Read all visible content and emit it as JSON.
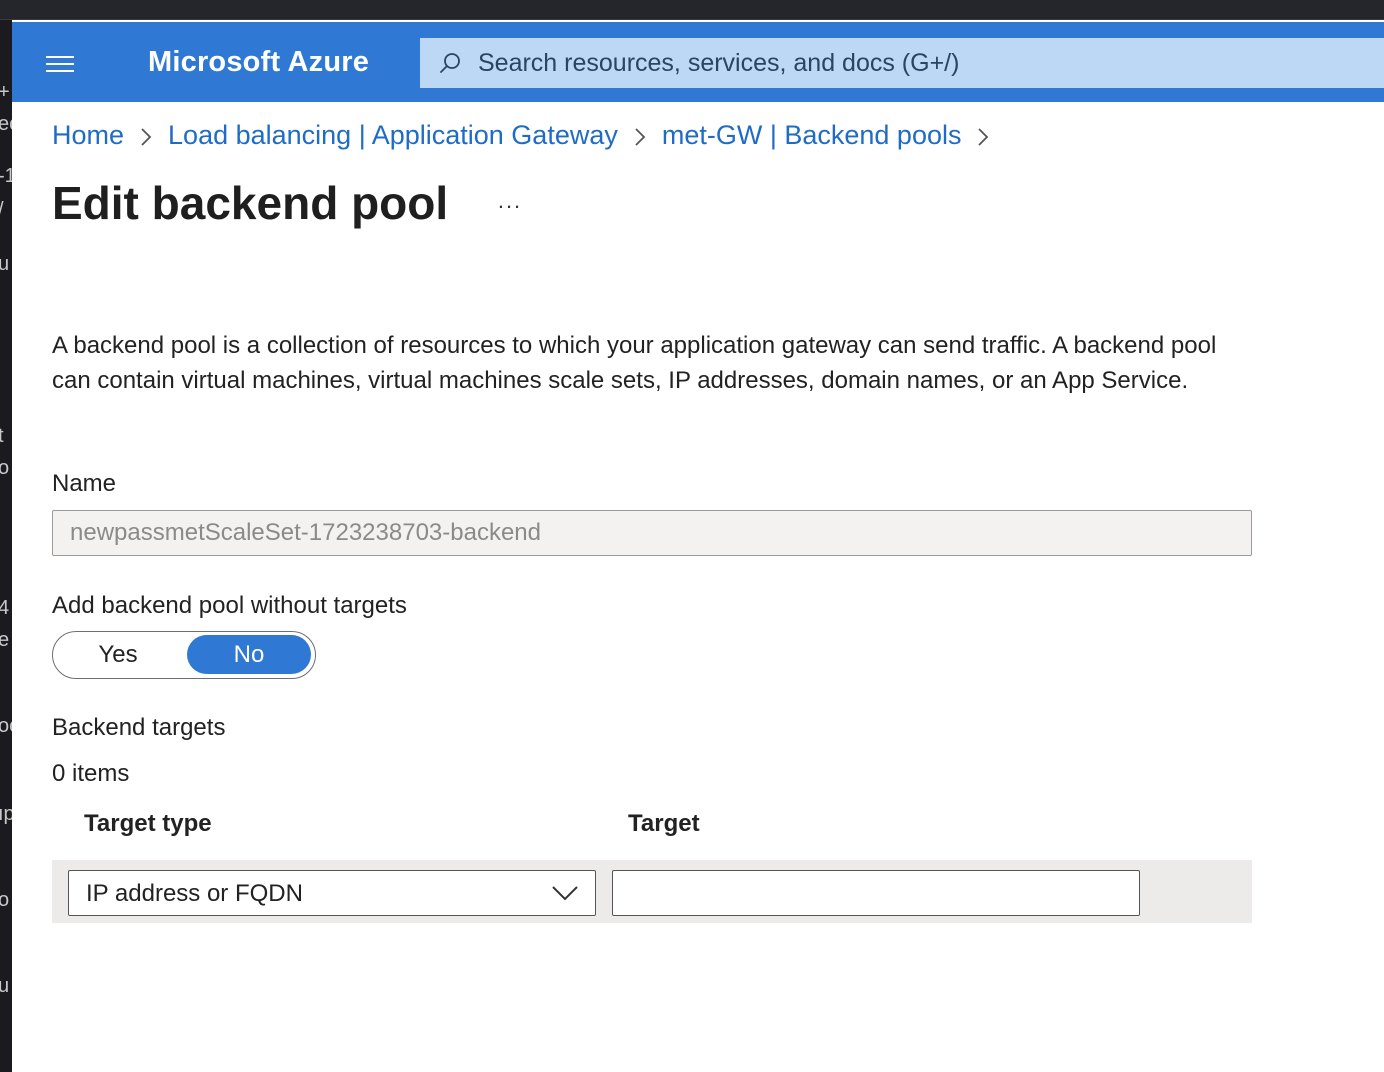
{
  "header": {
    "brand": "Microsoft Azure",
    "search_placeholder": "Search resources, services, and docs (G+/)"
  },
  "breadcrumb": {
    "items": [
      "Home",
      "Load balancing | Application Gateway",
      "met-GW | Backend pools"
    ]
  },
  "page": {
    "title": "Edit backend pool",
    "more": "...",
    "description": "A backend pool is a collection of resources to which your application gateway can send traffic. A backend pool can contain virtual machines, virtual machines scale sets, IP addresses, domain names, or an App Service."
  },
  "form": {
    "name_label": "Name",
    "name_value": "newpassmetScaleSet-1723238703-backend",
    "without_targets_label": "Add backend pool without targets",
    "toggle": {
      "yes": "Yes",
      "no": "No",
      "selected": "No"
    },
    "backend_targets_label": "Backend targets",
    "items_count": "0 items",
    "columns": {
      "target_type": "Target type",
      "target": "Target"
    },
    "row": {
      "target_type_value": "IP address or FQDN",
      "target_value": ""
    }
  },
  "left_edge": {
    "glyphs": [
      "+",
      "ec",
      "-1",
      "/",
      "u",
      "t",
      "o",
      "4",
      "e",
      "oc",
      "ıp",
      "o",
      "u"
    ]
  },
  "colors": {
    "header": "#2f78d3",
    "search": "#bcd8f5",
    "link": "#1f6cc7",
    "toggle_selected": "#2f78d3"
  }
}
